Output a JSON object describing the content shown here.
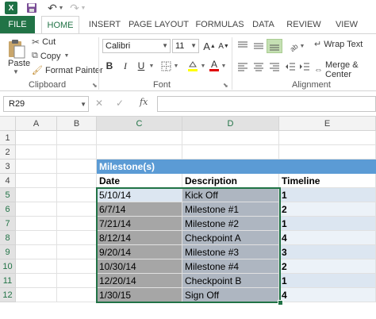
{
  "app": {
    "logo_text": "X"
  },
  "tabs": [
    "FILE",
    "HOME",
    "INSERT",
    "PAGE LAYOUT",
    "FORMULAS",
    "DATA",
    "REVIEW",
    "VIEW"
  ],
  "clipboard": {
    "paste": "Paste",
    "cut": "Cut",
    "copy": "Copy",
    "format_painter": "Format Painter",
    "group": "Clipboard"
  },
  "font": {
    "name": "Calibri",
    "size": "11",
    "bold": "B",
    "italic": "I",
    "underline": "U",
    "group": "Font"
  },
  "alignment": {
    "wrap": "Wrap Text",
    "merge": "Merge & Center",
    "group": "Alignment"
  },
  "formula_bar": {
    "name_box": "R29",
    "fx": "fx",
    "value": ""
  },
  "columns": [
    "A",
    "B",
    "C",
    "D",
    "E"
  ],
  "rows": [
    "1",
    "2",
    "3",
    "4",
    "5",
    "6",
    "7",
    "8",
    "9",
    "10",
    "11",
    "12"
  ],
  "sheet": {
    "banner": "Milestone(s)",
    "headers": {
      "date": "Date",
      "description": "Description",
      "timeline": "Timeline"
    },
    "records": [
      {
        "date": "5/10/14",
        "description": "Kick Off",
        "timeline": "1"
      },
      {
        "date": "6/7/14",
        "description": "Milestone #1",
        "timeline": "2"
      },
      {
        "date": "7/21/14",
        "description": "Milestone #2",
        "timeline": "1"
      },
      {
        "date": "8/12/14",
        "description": "Checkpoint A",
        "timeline": "4"
      },
      {
        "date": "9/20/14",
        "description": "Milestone #3",
        "timeline": "3"
      },
      {
        "date": "10/30/14",
        "description": "Milestone #4",
        "timeline": "2"
      },
      {
        "date": "12/20/14",
        "description": "Checkpoint B",
        "timeline": "1"
      },
      {
        "date": "1/30/15",
        "description": "Sign Off",
        "timeline": "4"
      }
    ]
  },
  "colors": {
    "accent": "#217346",
    "banner": "#5b9bd5"
  }
}
